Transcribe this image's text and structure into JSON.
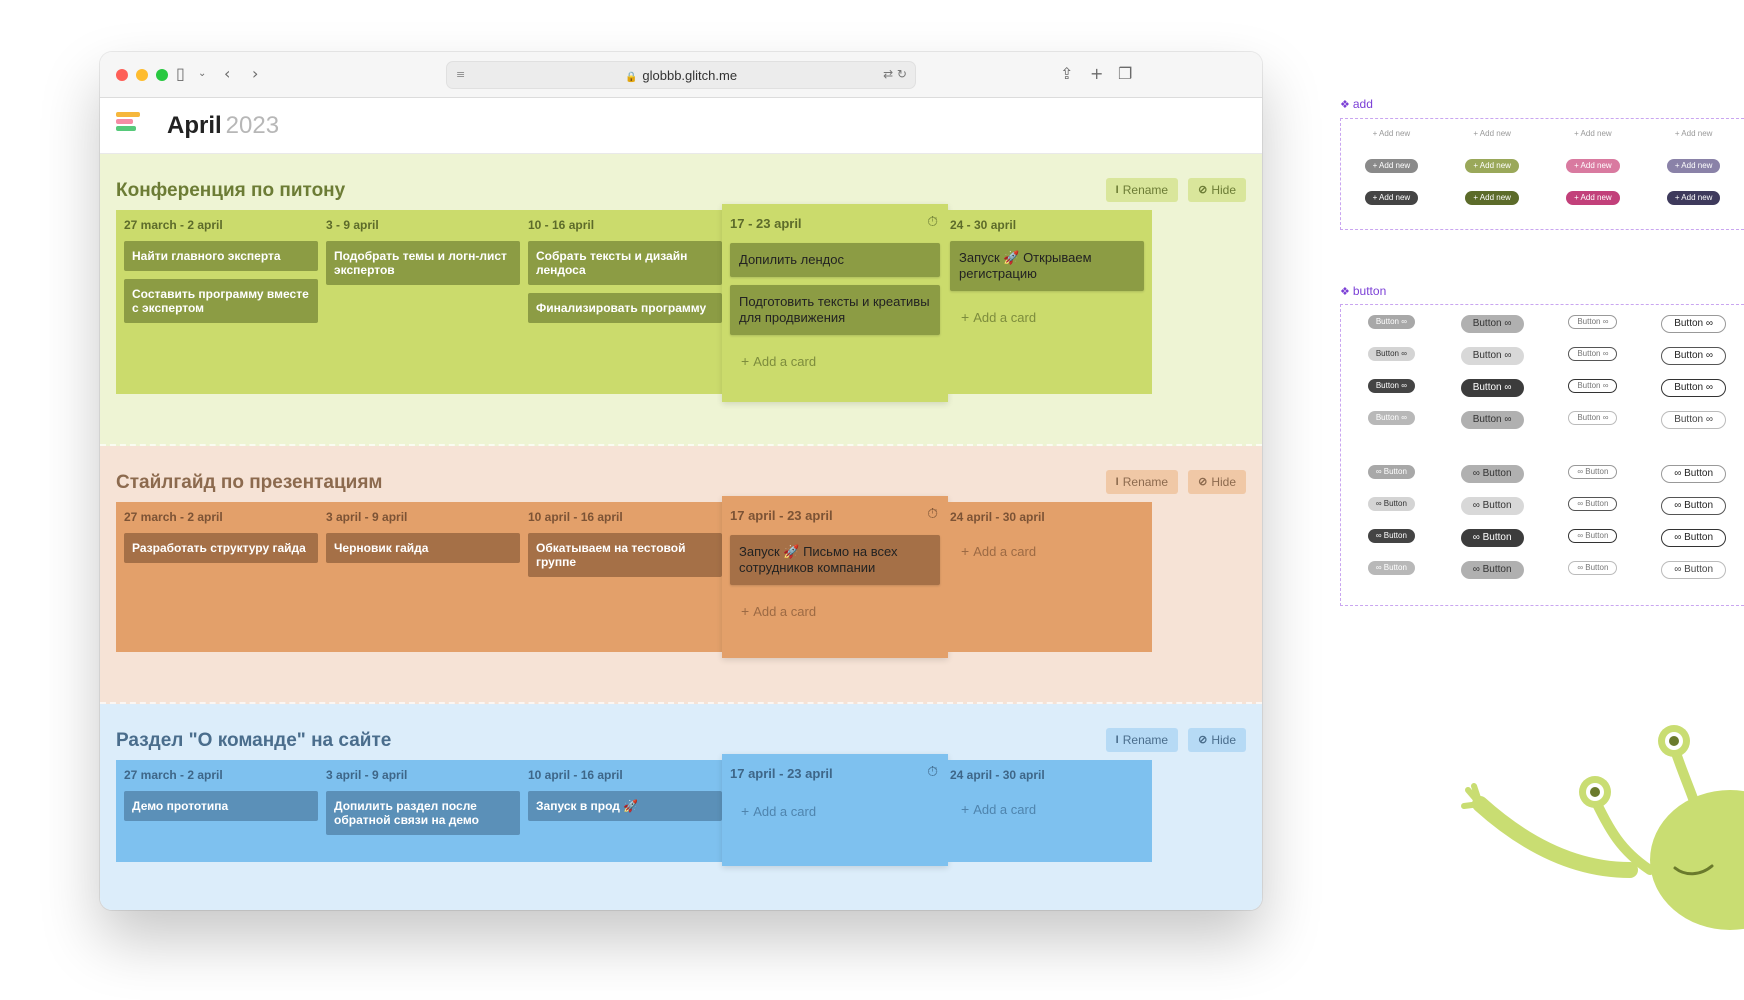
{
  "browser": {
    "url": "globbb.glitch.me"
  },
  "app": {
    "month": "April",
    "year": "2023",
    "logo_colors": [
      "#f6b73c",
      "#f58ca5",
      "#56c97a"
    ]
  },
  "actions": {
    "rename": "Rename",
    "hide": "Hide",
    "add_card": "Add a card"
  },
  "projects": [
    {
      "title": "Конференция по питону",
      "weeks": [
        {
          "title": "27 march - 2 april",
          "cards": [
            "Найти главного эксперта",
            "Составить программу вместе с экспертом"
          ]
        },
        {
          "title": "3 - 9 april",
          "cards": [
            "Подобрать темы и логн-лист экспертов"
          ]
        },
        {
          "title": "10 - 16 april",
          "cards": [
            "Собрать тексты и дизайн лендоса",
            "Финализировать программу"
          ]
        },
        {
          "title": "17 - 23 april",
          "cards": [
            "Допилить лендос",
            "Подготовить тексты и креативы для продвижения"
          ]
        },
        {
          "title": "24 - 30 april",
          "cards": [
            "Запуск 🚀 Открываем регистрацию"
          ]
        }
      ]
    },
    {
      "title": "Стайлгайд по презентациям",
      "weeks": [
        {
          "title": "27 march - 2 april",
          "cards": [
            "Разработать структуру гайда"
          ]
        },
        {
          "title": "3 april - 9 april",
          "cards": [
            "Черновик гайда"
          ]
        },
        {
          "title": "10 april - 16 april",
          "cards": [
            "Обкатываем на тестовой группе"
          ]
        },
        {
          "title": "17 april - 23 april",
          "cards": [
            "Запуск 🚀 Письмо на всех сотрудников компании"
          ]
        },
        {
          "title": "24 april - 30 april",
          "cards": []
        }
      ]
    },
    {
      "title": "Раздел \"О команде\" на сайте",
      "weeks": [
        {
          "title": "27 march - 2 april",
          "cards": [
            "Демо прототипа"
          ]
        },
        {
          "title": "3 april - 9 april",
          "cards": [
            "Допилить раздел после обратной связи на демо"
          ]
        },
        {
          "title": "10 april - 16 april",
          "cards": [
            "Запуск в прод 🚀"
          ]
        },
        {
          "title": "17 april - 23 april",
          "cards": []
        },
        {
          "title": "24 april - 30 april",
          "cards": []
        }
      ]
    }
  ],
  "components": {
    "add": {
      "label": "add",
      "pill_label": "+ Add new",
      "columns": [
        "#8a8a8a",
        "#9aa85a",
        "#d97aa0",
        "#8a82a8"
      ],
      "dark_columns": [
        "#444444",
        "#5c6b2a",
        "#c2407a",
        "#3e3a5c"
      ]
    },
    "button": {
      "label": "button",
      "text_right": "Button ∞",
      "text_left": "∞ Button"
    }
  }
}
